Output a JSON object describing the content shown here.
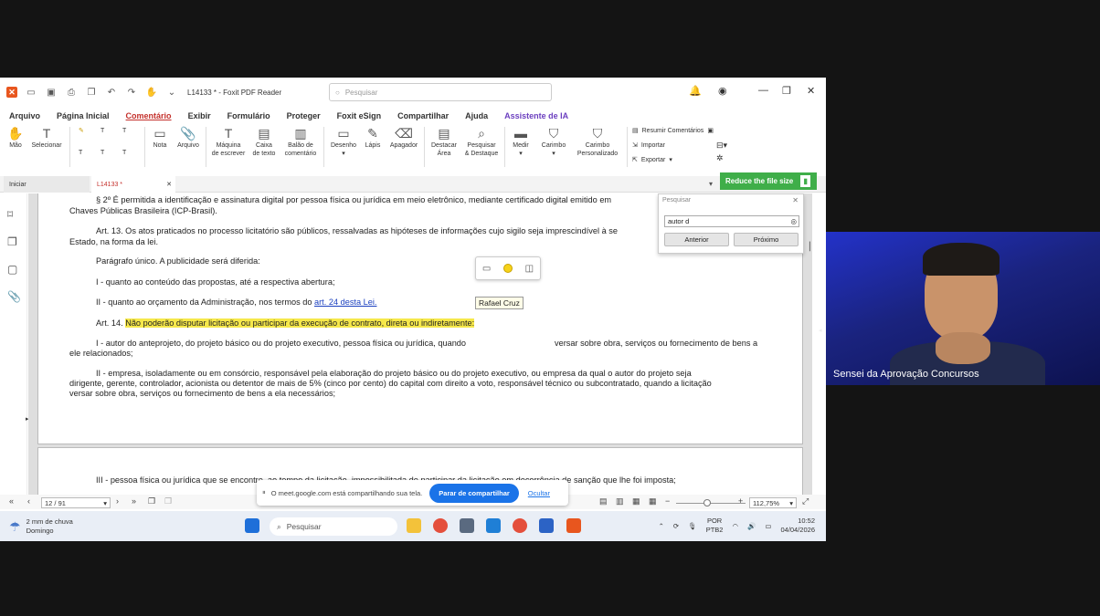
{
  "window": {
    "title": "L14133 * - Foxit PDF Reader",
    "search_placeholder": "Pesquisar"
  },
  "menu": [
    "Arquivo",
    "Página Inicial",
    "Comentário",
    "Exibir",
    "Formulário",
    "Proteger",
    "Foxit eSign",
    "Compartilhar",
    "Ajuda",
    "Assistente de IA"
  ],
  "ribbon": {
    "mao": "Mão",
    "selecionar": "Selecionar",
    "nota": "Nota",
    "arquivo": "Arquivo",
    "maquina_1": "Máquina",
    "maquina_2": "de escrever",
    "caixa_1": "Caixa",
    "caixa_2": "de texto",
    "balao_1": "Balão de",
    "balao_2": "comentário",
    "desenho": "Desenho",
    "lapis": "Lápis",
    "apagador": "Apagador",
    "destacar_1": "Destacar",
    "destacar_2": "Área",
    "pesquisar_1": "Pesquisar",
    "pesquisar_2": "& Destaque",
    "medir": "Medir",
    "carimbo": "Carimbo",
    "carimbo_p_1": "Carimbo",
    "carimbo_p_2": "Personalizado",
    "resumir": "Resumir Comentários",
    "importar": "Importar",
    "exportar": "Exportar"
  },
  "tabs": {
    "home": "Iniciar",
    "doc": "L14133 *"
  },
  "reduce_banner": "Reduce the file size",
  "find_panel": {
    "title": "Pesquisar",
    "query": "autor d",
    "prev": "Anterior",
    "next": "Próximo"
  },
  "doc": {
    "l1": "§ 2º É permitida a identificação e assinatura digital por pessoa física ou jurídica em meio eletrônico, mediante certificado digital emitido em",
    "l1b": "Chaves Públicas Brasileira (ICP-Brasil).",
    "l2": "Art. 13. Os atos praticados no processo licitatório são públicos, ressalvadas as hipóteses de informações cujo sigilo seja imprescindível à se",
    "l2b": "Estado, na forma da lei.",
    "l3": "Parágrafo único. A publicidade será diferida:",
    "l4": "I - quanto ao conteúdo das propostas, até a respectiva abertura;",
    "l5": "II - quanto ao orçamento da Administração, nos termos do",
    "l5_link": "art. 24 desta Lei.",
    "l6_pre": "Art. 14.",
    "l6_hl": "Não poderão disputar licitação ou participar da execução de contrato, direta ou indiretamente:",
    "l7a": "I - autor do anteprojeto, do projeto básico ou do projeto executivo, pessoa física ou jurídica, quando",
    "l7b": "versar sobre obra, serviços ou fornecimento de bens a",
    "l7c": "ele relacionados;",
    "l8a": "II - empresa, isoladamente ou em consórcio, responsável pela elaboração do projeto básico ou do projeto executivo, ou empresa da qual o autor do projeto seja",
    "l8b": "dirigente, gerente, controlador, acionista ou detentor de mais de 5% (cinco por cento) do capital com direito a voto, responsável técnico ou subcontratado, quando a licitação",
    "l8c": "versar sobre obra, serviços ou fornecimento de bens a ela necessários;",
    "l9": "III - pessoa física ou jurídica que se encontre, ao tempo da licitação, impossibilitada de participar da licitação em decorrência de sanção que lhe foi imposta;",
    "comment_author": "Rafael Cruz"
  },
  "status": {
    "page": "12 / 91",
    "zoom": "112,75%"
  },
  "share": {
    "text": "O meet.google.com está compartilhando sua tela.",
    "stop": "Parar de compartilhar",
    "hide": "Ocultar"
  },
  "taskbar": {
    "weather_1": "2 mm de chuva",
    "weather_2": "Domingo",
    "search": "Pesquisar",
    "lang_1": "POR",
    "lang_2": "PTB2",
    "time": "10:52",
    "date": "04/04/2026"
  },
  "video": {
    "name": "Sensei da Aprovação Concursos"
  },
  "colors": {
    "accent": "#c4302b",
    "highlight": "#f6e84a",
    "reduce_green": "#3fae49",
    "share_blue": "#1a73e8"
  }
}
